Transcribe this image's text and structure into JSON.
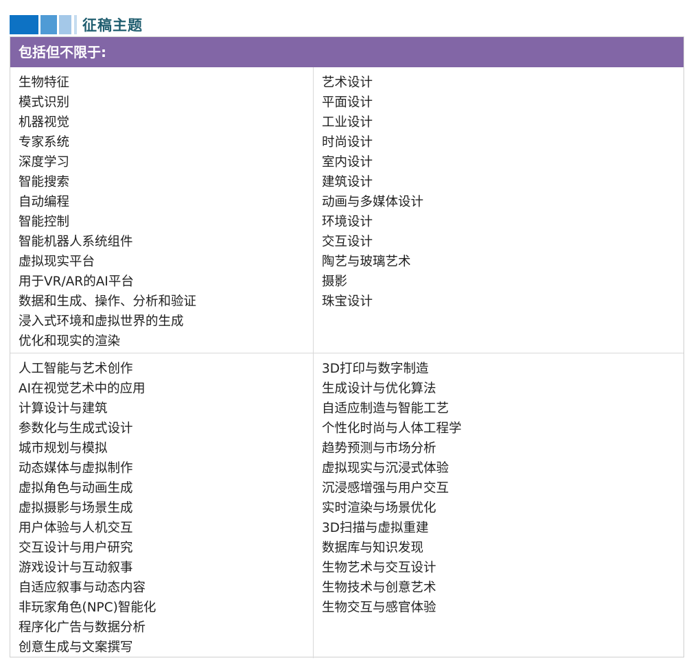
{
  "section": {
    "title": "征稿主题"
  },
  "banner": {
    "label": "包括但不限于:"
  },
  "rows": [
    {
      "left": [
        "生物特征",
        "模式识别",
        "机器视觉",
        "专家系统",
        "深度学习",
        "智能搜索",
        "自动编程",
        "智能控制",
        "智能机器人系统组件",
        "虚拟现实平台",
        "用于VR/AR的AI平台",
        "数据和生成、操作、分析和验证",
        "浸入式环境和虚拟世界的生成",
        "优化和现实的渲染"
      ],
      "right": [
        "艺术设计",
        "平面设计",
        "工业设计",
        "时尚设计",
        "室内设计",
        "建筑设计",
        "动画与多媒体设计",
        "环境设计",
        "交互设计",
        "陶艺与玻璃艺术",
        "摄影",
        "珠宝设计"
      ]
    },
    {
      "left": [
        "人工智能与艺术创作",
        "AI在视觉艺术中的应用",
        "计算设计与建筑",
        "参数化与生成式设计",
        "城市规划与模拟",
        "动态媒体与虚拟制作",
        "虚拟角色与动画生成",
        "虚拟摄影与场景生成",
        "用户体验与人机交互",
        "交互设计与用户研究",
        "游戏设计与互动叙事",
        "自适应叙事与动态内容",
        "非玩家角色(NPC)智能化",
        "程序化广告与数据分析",
        "创意生成与文案撰写"
      ],
      "right": [
        "3D打印与数字制造",
        "生成设计与优化算法",
        "自适应制造与智能工艺",
        "个性化时尚与人体工程学",
        "趋势预测与市场分析",
        "虚拟现实与沉浸式体验",
        "沉浸感增强与用户交互",
        "实时渲染与场景优化",
        "3D扫描与虚拟重建",
        "数据库与知识发现",
        "生物艺术与交互设计",
        "生物技术与创意艺术",
        "生物交互与感官体验"
      ]
    }
  ]
}
